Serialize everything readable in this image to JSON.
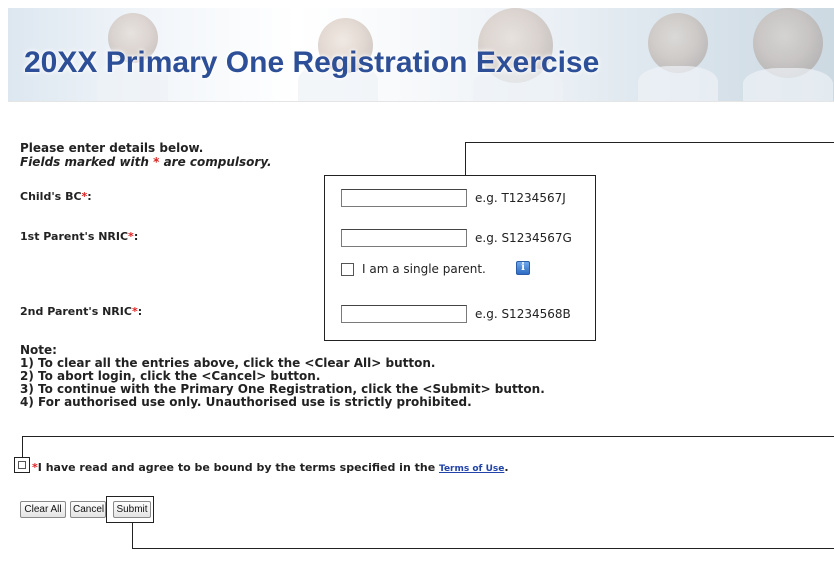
{
  "banner": {
    "title": "20XX Primary One Registration Exercise"
  },
  "intro": {
    "line1": "Please enter details below.",
    "line2_prefix": "Fields marked with ",
    "required_mark": "*",
    "line2_suffix": " are compulsory."
  },
  "fields": {
    "child_bc": {
      "label": "Child's BC",
      "value": "",
      "example": "e.g. T1234567J"
    },
    "parent1_nric": {
      "label": "1st Parent's NRIC",
      "value": "",
      "example": "e.g. S1234567G"
    },
    "parent2_nric": {
      "label": "2nd Parent's NRIC",
      "value": "",
      "example": "e.g. S1234568B"
    }
  },
  "single_parent": {
    "label": "I am a single parent.",
    "checked": false,
    "info_icon": "info-icon",
    "info_glyph": "i"
  },
  "notes": {
    "heading": "Note:",
    "items": [
      "1)  To clear all the entries above, click the <Clear All> button.",
      "2)  To abort login, click the <Cancel> button.",
      "3)  To continue with the Primary One Registration, click the <Submit> button.",
      "4)  For authorised use only. Unauthorised use is strictly prohibited."
    ]
  },
  "terms": {
    "required_mark": "*",
    "text": "I have read and agree to be bound by the terms specified in the ",
    "link": "Terms of Use",
    "end": ".",
    "checked": false
  },
  "buttons": {
    "clear_all": "Clear All",
    "cancel": "Cancel",
    "submit": "Submit"
  },
  "colors": {
    "title": "#2c4f97",
    "required": "#dd2222",
    "link": "#2244aa"
  }
}
